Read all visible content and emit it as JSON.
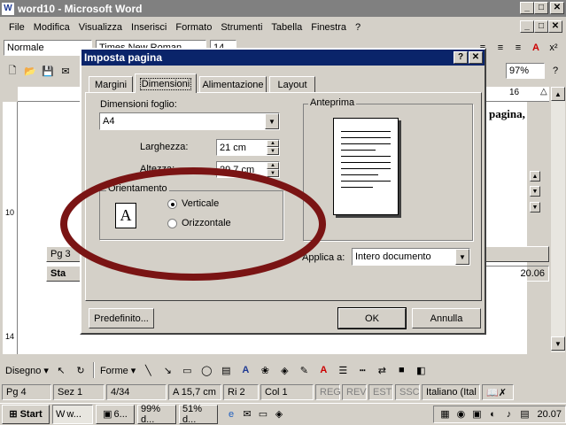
{
  "window": {
    "title": "word10 - Microsoft Word"
  },
  "menu": [
    "File",
    "Modifica",
    "Visualizza",
    "Inserisci",
    "Formato",
    "Strumenti",
    "Tabella",
    "Finestra",
    "?"
  ],
  "format_toolbar": {
    "style": "Normale",
    "font": "Times New Roman",
    "size": "14"
  },
  "std_toolbar": {
    "zoom": "97%"
  },
  "doc_fragment": "pagina,",
  "dialog": {
    "title": "Imposta pagina",
    "tabs": [
      "Margini",
      "Dimensioni",
      "Alimentazione",
      "Layout"
    ],
    "paper_size_label": "Dimensioni foglio:",
    "paper_size_value": "A4",
    "width_label": "Larghezza:",
    "width_value": "21 cm",
    "height_label": "Altezza:",
    "height_value": "29,7 cm",
    "orientation_label": "Orientamento",
    "portrait_label": "Verticale",
    "landscape_label": "Orizzontale",
    "orientation_icon_letter": "A",
    "preview_label": "Anteprima",
    "apply_to_label": "Applica a:",
    "apply_to_value": "Intero documento",
    "default_button": "Predefinito...",
    "ok_button": "OK",
    "cancel_button": "Annulla"
  },
  "behind": {
    "pg_label": "Pg 3",
    "start_label": "Sta",
    "time_small": "20.06"
  },
  "drawing_toolbar": {
    "draw_label": "Disegno",
    "shapes_label": "Forme"
  },
  "statusbar": {
    "page": "Pg 4",
    "section": "Sez 1",
    "pages": "4/34",
    "position": "A 15,7 cm",
    "line": "Ri 2",
    "column": "Col 1",
    "rec": "REG",
    "rev": "REV",
    "ext": "EST",
    "ovr": "SSC",
    "language": "Italiano (Ital"
  },
  "taskbar": {
    "start": "Start",
    "tasks": [
      "w...",
      "6...",
      "99% d...",
      "51% d..."
    ],
    "clock": "20.07"
  },
  "ruler_numbers": [
    "16"
  ],
  "colors": {
    "title_active": "#0a246a",
    "title_inactive": "#808080",
    "annotation_ellipse": "#7a1414"
  }
}
